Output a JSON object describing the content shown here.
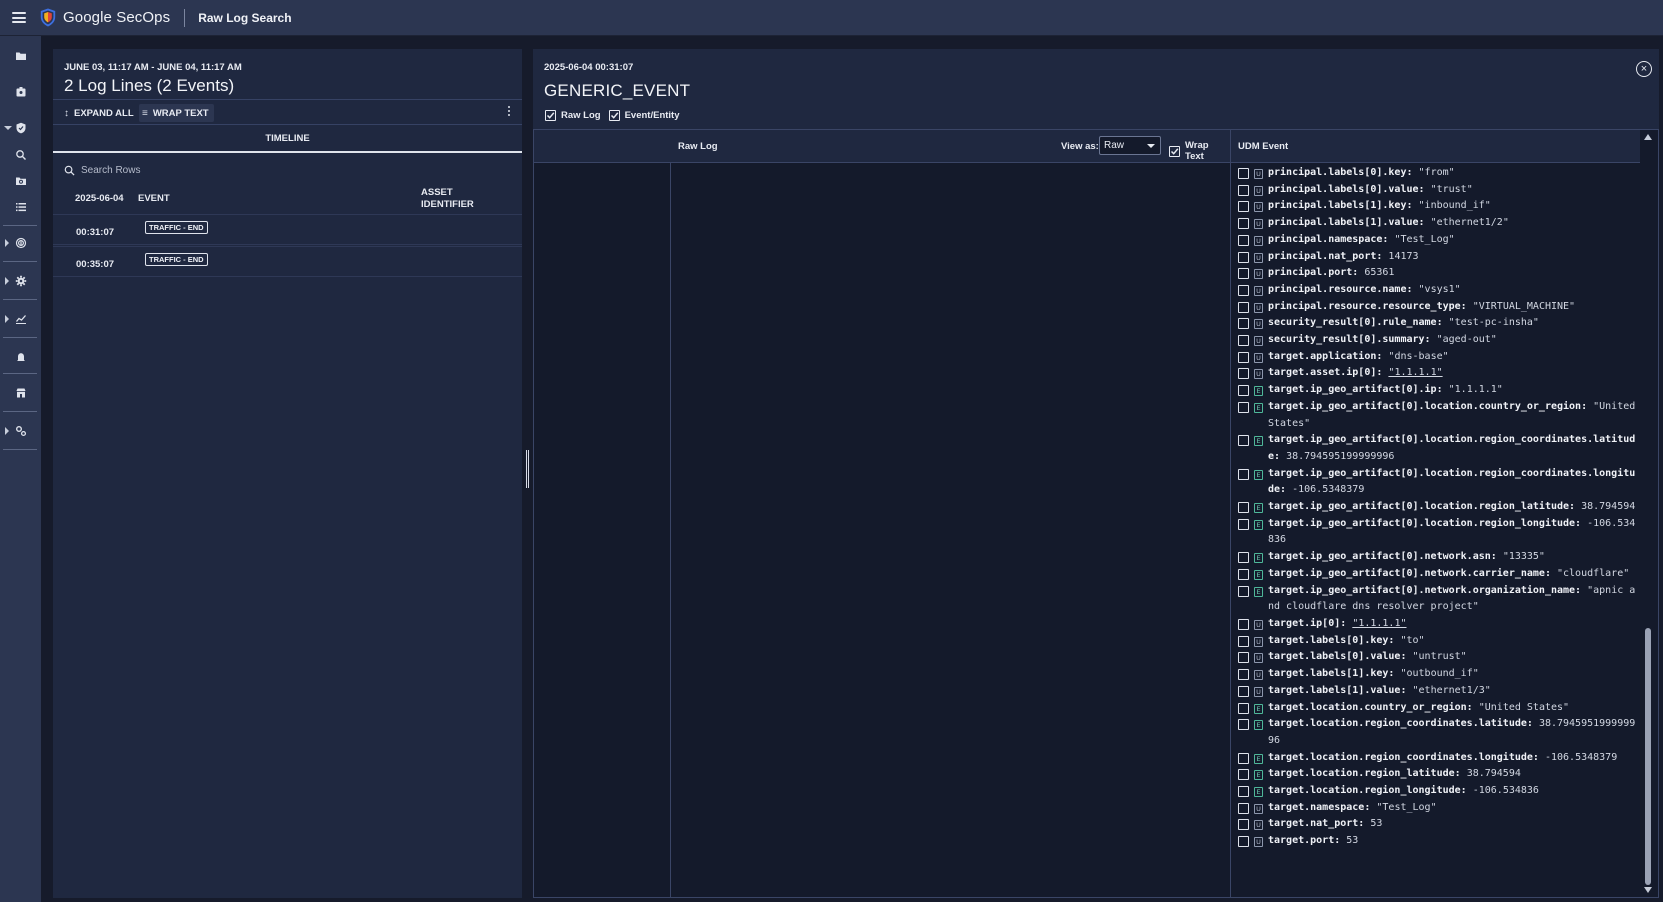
{
  "header": {
    "brand": "Google SecOps",
    "page_name": "Raw Log Search"
  },
  "nav_icons": [
    "folder-icon",
    "case-icon",
    "shield-icon",
    "search-icon",
    "folder-search-icon",
    "list-icon",
    "fingerprint-icon",
    "gear-icon",
    "chart-icon",
    "bell-icon",
    "store-icon",
    "settings-icon"
  ],
  "left_panel": {
    "range": "JUNE 03, 11:17 AM - JUNE 04, 11:17 AM",
    "title": "2 Log Lines (2 Events)",
    "expand_all": "EXPAND ALL",
    "wrap_text": "WRAP TEXT",
    "tab": "TIMELINE",
    "search_placeholder": "Search Rows",
    "columns": {
      "date": "2025-06-04",
      "event": "EVENT",
      "asset": "ASSET IDENTIFIER"
    },
    "rows": [
      {
        "time": "00:31:07",
        "event": "TRAFFIC - END"
      },
      {
        "time": "00:35:07",
        "event": "TRAFFIC - END"
      }
    ]
  },
  "right_panel": {
    "timestamp": "2025-06-04 00:31:07",
    "title": "GENERIC_EVENT",
    "close_symbol": "×",
    "raw_log_check": "Raw Log",
    "event_entity_check": "Event/Entity",
    "raw_log_header": "Raw Log",
    "view_as_label": "View as:",
    "view_as_value": "Raw",
    "wrap_text_label": "Wrap Text",
    "udm_header": "UDM Event"
  },
  "udm_fields": [
    {
      "tag": "U",
      "key": "principal.labels[0].key:",
      "value": "\"from\""
    },
    {
      "tag": "U",
      "key": "principal.labels[0].value:",
      "value": "\"trust\""
    },
    {
      "tag": "U",
      "key": "principal.labels[1].key:",
      "value": "\"inbound_if\""
    },
    {
      "tag": "U",
      "key": "principal.labels[1].value:",
      "value": "\"ethernet1/2\""
    },
    {
      "tag": "U",
      "key": "principal.namespace:",
      "value": "\"Test_Log\""
    },
    {
      "tag": "U",
      "key": "principal.nat_port:",
      "value": "14173"
    },
    {
      "tag": "U",
      "key": "principal.port:",
      "value": "65361"
    },
    {
      "tag": "U",
      "key": "principal.resource.name:",
      "value": "\"vsys1\""
    },
    {
      "tag": "U",
      "key": "principal.resource.resource_type:",
      "value": "\"VIRTUAL_MACHINE\""
    },
    {
      "tag": "U",
      "key": "security_result[0].rule_name:",
      "value": "\"test-pc-insha\""
    },
    {
      "tag": "U",
      "key": "security_result[0].summary:",
      "value": "\"aged-out\""
    },
    {
      "tag": "U",
      "key": "target.application:",
      "value": "\"dns-base\""
    },
    {
      "tag": "U",
      "key": "target.asset.ip[0]:",
      "value": "\"1.1.1.1\"",
      "link": true
    },
    {
      "tag": "E",
      "key": "target.ip_geo_artifact[0].ip:",
      "value": "\"1.1.1.1\""
    },
    {
      "tag": "E",
      "key": "target.ip_geo_artifact[0].location.country_or_region:",
      "value": "\"United States\""
    },
    {
      "tag": "E",
      "key": "target.ip_geo_artifact[0].location.region_coordinates.latitude:",
      "value": "38.794595199999996"
    },
    {
      "tag": "E",
      "key": "target.ip_geo_artifact[0].location.region_coordinates.longitude:",
      "value": "-106.5348379"
    },
    {
      "tag": "E",
      "key": "target.ip_geo_artifact[0].location.region_latitude:",
      "value": "38.794594"
    },
    {
      "tag": "E",
      "key": "target.ip_geo_artifact[0].location.region_longitude:",
      "value": "-106.534836"
    },
    {
      "tag": "E",
      "key": "target.ip_geo_artifact[0].network.asn:",
      "value": "\"13335\""
    },
    {
      "tag": "E",
      "key": "target.ip_geo_artifact[0].network.carrier_name:",
      "value": "\"cloudflare\""
    },
    {
      "tag": "E",
      "key": "target.ip_geo_artifact[0].network.organization_name:",
      "value": "\"apnic and cloudflare dns resolver project\""
    },
    {
      "tag": "U",
      "key": "target.ip[0]:",
      "value": "\"1.1.1.1\"",
      "link": true
    },
    {
      "tag": "U",
      "key": "target.labels[0].key:",
      "value": "\"to\""
    },
    {
      "tag": "U",
      "key": "target.labels[0].value:",
      "value": "\"untrust\""
    },
    {
      "tag": "U",
      "key": "target.labels[1].key:",
      "value": "\"outbound_if\""
    },
    {
      "tag": "U",
      "key": "target.labels[1].value:",
      "value": "\"ethernet1/3\""
    },
    {
      "tag": "E",
      "key": "target.location.country_or_region:",
      "value": "\"United States\""
    },
    {
      "tag": "E",
      "key": "target.location.region_coordinates.latitude:",
      "value": "38.794595199999996"
    },
    {
      "tag": "E",
      "key": "target.location.region_coordinates.longitude:",
      "value": "-106.5348379"
    },
    {
      "tag": "E",
      "key": "target.location.region_latitude:",
      "value": "38.794594"
    },
    {
      "tag": "E",
      "key": "target.location.region_longitude:",
      "value": "-106.534836"
    },
    {
      "tag": "U",
      "key": "target.namespace:",
      "value": "\"Test_Log\""
    },
    {
      "tag": "U",
      "key": "target.nat_port:",
      "value": "53"
    },
    {
      "tag": "U",
      "key": "target.port:",
      "value": "53"
    }
  ],
  "colors": {
    "topbar": "#2c3651",
    "panel": "#1f2840",
    "content": "#141a2b",
    "entity_tag": "#4fb89a",
    "shield_red": "#e0453a",
    "shield_blue": "#3d6fe0"
  }
}
